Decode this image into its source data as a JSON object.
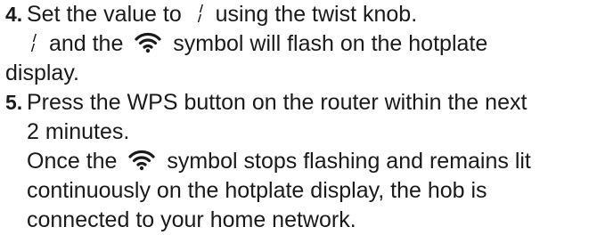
{
  "step4": {
    "number": "4.",
    "line1_before": "Set the value to",
    "line1_after": "using the twist knob.",
    "line2_mid": "and the",
    "line2_after": "symbol will flash on the hotplate",
    "line3": "display.",
    "value_display": "1"
  },
  "step5": {
    "number": "5.",
    "line1": "Press the WPS button on the router within the next",
    "line2": "2 minutes.",
    "line3_before": "Once the",
    "line3_after": "symbol stops flashing and remains lit",
    "line4": "continuously on the hotplate display, the hob is",
    "line5": "connected to your home network."
  },
  "icons": {
    "wifi": "wifi-icon",
    "display_digit": "display-digit-one-icon"
  },
  "colors": {
    "text": "#1a1a1a",
    "background": "#ffffff"
  }
}
